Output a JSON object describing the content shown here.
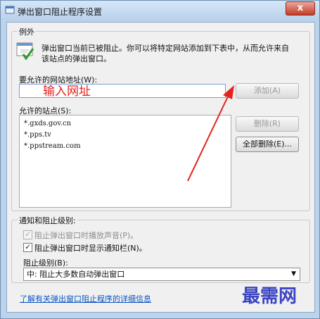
{
  "window": {
    "title": "弹出窗口阻止程序设置",
    "close_glyph": "x"
  },
  "exceptions": {
    "legend": "例外",
    "description": "弹出窗口当前已被阻止。你可以将特定网站添加到下表中，从而允许来自该站点的弹出窗口。",
    "address_label": "要允许的网站地址(W):",
    "address_value": "",
    "annotation_text": "输入网址",
    "add_button": "添加(A)",
    "allowed_label": "允许的站点(S):",
    "allowed_sites": [
      "*.gxds.gov.cn",
      "*.pps.tv",
      "*.ppstream.com"
    ],
    "remove_button": "删除(R)",
    "remove_all_button": "全部删除(E)..."
  },
  "notifications": {
    "legend": "通知和阻止级别:",
    "play_sound_label": "阻止弹出窗口时播放声音(P)。",
    "play_sound_checked": true,
    "show_bar_label": "阻止弹出窗口时显示通知栏(N)。",
    "show_bar_checked": true,
    "blocking_level_label": "阻止级别(B):",
    "blocking_level_value": "中: 阻止大多数自动弹出窗口"
  },
  "footer": {
    "learn_more_link": "了解有关弹出窗口阻止程序的详细信息",
    "watermark": "最需网"
  },
  "colors": {
    "annotation": "#e4231c",
    "link": "#0a55c5"
  }
}
